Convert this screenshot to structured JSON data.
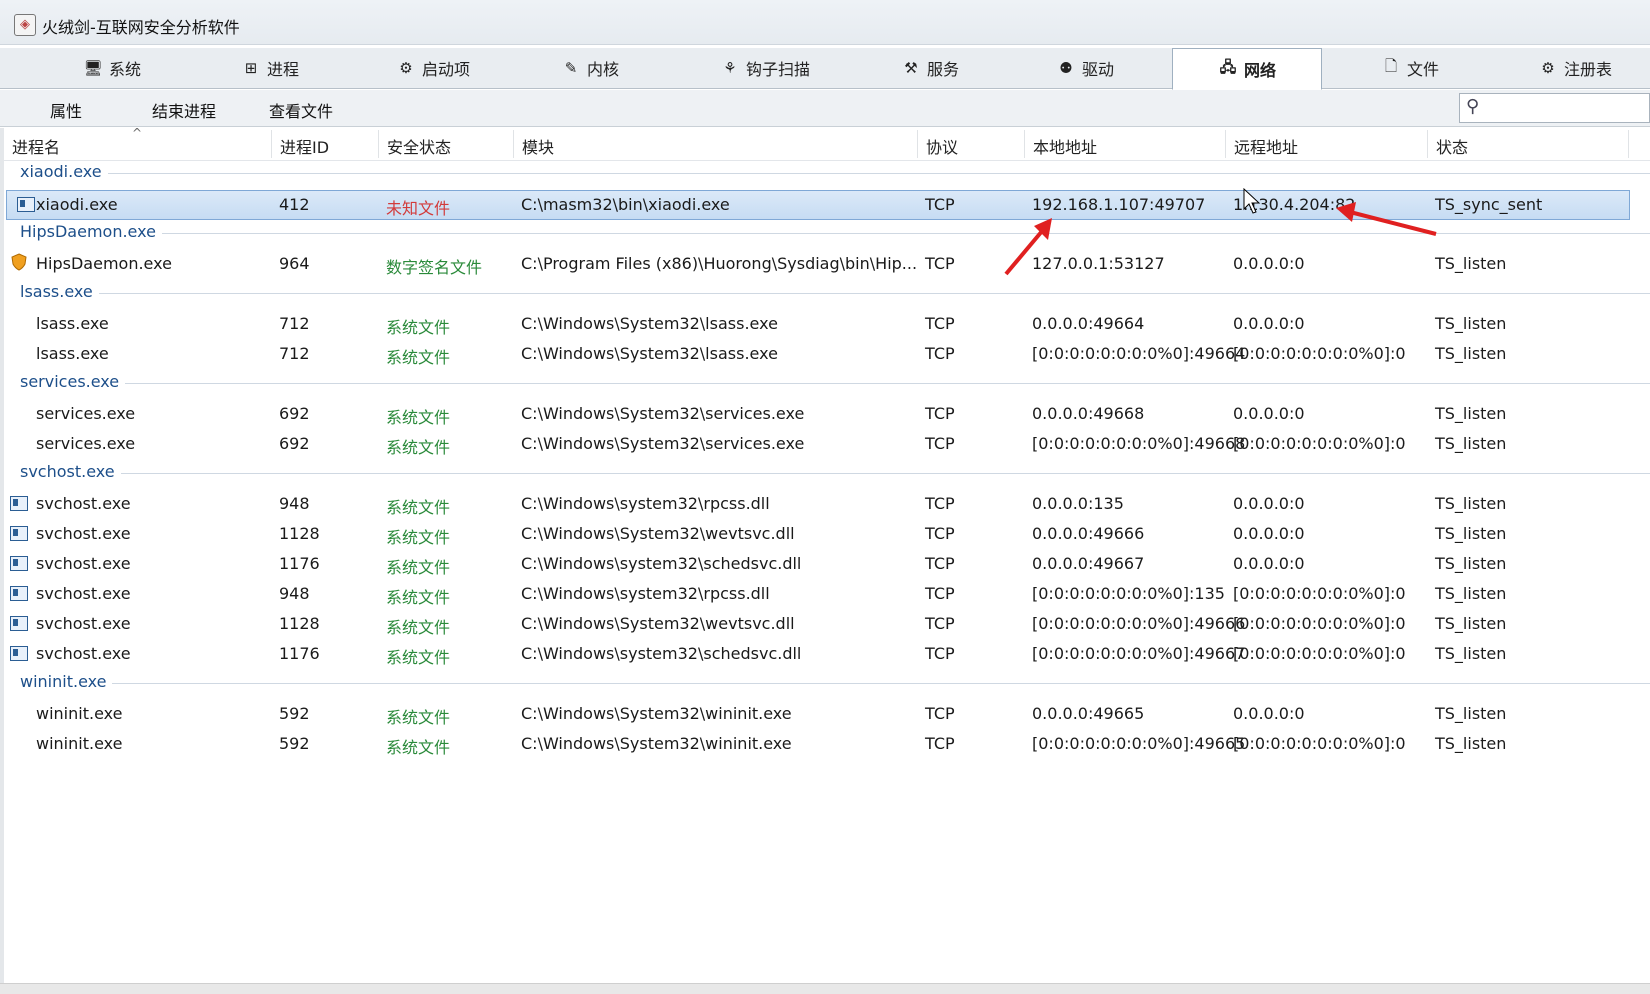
{
  "window": {
    "title": "火绒剑-互联网安全分析软件"
  },
  "tabs": [
    {
      "label": "系统",
      "icon": "monitor-icon"
    },
    {
      "label": "进程",
      "icon": "windows-logo-icon"
    },
    {
      "label": "启动项",
      "icon": "gear-icon"
    },
    {
      "label": "内核",
      "icon": "wrench-icon"
    },
    {
      "label": "钩子扫描",
      "icon": "bug-icon"
    },
    {
      "label": "服务",
      "icon": "services-icon"
    },
    {
      "label": "驱动",
      "icon": "driver-icon"
    },
    {
      "label": "网络",
      "icon": "network-icon",
      "active": true
    },
    {
      "label": "文件",
      "icon": "file-icon"
    },
    {
      "label": "注册表",
      "icon": "registry-icon"
    }
  ],
  "toolbar": {
    "properties": "属性",
    "end_process": "结束进程",
    "view_file": "查看文件"
  },
  "columns": [
    "进程名",
    "进程ID",
    "安全状态",
    "模块",
    "协议",
    "本地地址",
    "远程地址",
    "状态"
  ],
  "groups": [
    {
      "name": "xiaodi.exe",
      "rows": [
        {
          "name": "xiaodi.exe",
          "pid": "412",
          "security": "未知文件",
          "security_type": "unknown",
          "module": "C:\\masm32\\bin\\xiaodi.exe",
          "proto": "TCP",
          "local": "192.168.1.107:49707",
          "remote": "1.130.4.204:82",
          "state": "TS_sync_sent",
          "icon": "window",
          "selected": true
        }
      ]
    },
    {
      "name": "HipsDaemon.exe",
      "rows": [
        {
          "name": "HipsDaemon.exe",
          "pid": "964",
          "security": "数字签名文件",
          "security_type": "signed",
          "module": "C:\\Program Files (x86)\\Huorong\\Sysdiag\\bin\\Hip...",
          "proto": "TCP",
          "local": "127.0.0.1:53127",
          "remote": "0.0.0.0:0",
          "state": "TS_listen",
          "icon": "shield"
        }
      ]
    },
    {
      "name": "lsass.exe",
      "rows": [
        {
          "name": "lsass.exe",
          "pid": "712",
          "security": "系统文件",
          "security_type": "system",
          "module": "C:\\Windows\\System32\\lsass.exe",
          "proto": "TCP",
          "local": "0.0.0.0:49664",
          "remote": "0.0.0.0:0",
          "state": "TS_listen",
          "icon": ""
        },
        {
          "name": "lsass.exe",
          "pid": "712",
          "security": "系统文件",
          "security_type": "system",
          "module": "C:\\Windows\\System32\\lsass.exe",
          "proto": "TCP",
          "local": "[0:0:0:0:0:0:0:0%0]:49664",
          "remote": "[0:0:0:0:0:0:0:0%0]:0",
          "state": "TS_listen",
          "icon": ""
        }
      ]
    },
    {
      "name": "services.exe",
      "rows": [
        {
          "name": "services.exe",
          "pid": "692",
          "security": "系统文件",
          "security_type": "system",
          "module": "C:\\Windows\\System32\\services.exe",
          "proto": "TCP",
          "local": "0.0.0.0:49668",
          "remote": "0.0.0.0:0",
          "state": "TS_listen",
          "icon": ""
        },
        {
          "name": "services.exe",
          "pid": "692",
          "security": "系统文件",
          "security_type": "system",
          "module": "C:\\Windows\\System32\\services.exe",
          "proto": "TCP",
          "local": "[0:0:0:0:0:0:0:0%0]:49668",
          "remote": "[0:0:0:0:0:0:0:0%0]:0",
          "state": "TS_listen",
          "icon": ""
        }
      ]
    },
    {
      "name": "svchost.exe",
      "rows": [
        {
          "name": "svchost.exe",
          "pid": "948",
          "security": "系统文件",
          "security_type": "system",
          "module": "C:\\Windows\\system32\\rpcss.dll",
          "proto": "TCP",
          "local": "0.0.0.0:135",
          "remote": "0.0.0.0:0",
          "state": "TS_listen",
          "icon": "window"
        },
        {
          "name": "svchost.exe",
          "pid": "1128",
          "security": "系统文件",
          "security_type": "system",
          "module": "C:\\Windows\\System32\\wevtsvc.dll",
          "proto": "TCP",
          "local": "0.0.0.0:49666",
          "remote": "0.0.0.0:0",
          "state": "TS_listen",
          "icon": "window"
        },
        {
          "name": "svchost.exe",
          "pid": "1176",
          "security": "系统文件",
          "security_type": "system",
          "module": "C:\\Windows\\system32\\schedsvc.dll",
          "proto": "TCP",
          "local": "0.0.0.0:49667",
          "remote": "0.0.0.0:0",
          "state": "TS_listen",
          "icon": "window"
        },
        {
          "name": "svchost.exe",
          "pid": "948",
          "security": "系统文件",
          "security_type": "system",
          "module": "C:\\Windows\\system32\\rpcss.dll",
          "proto": "TCP",
          "local": "[0:0:0:0:0:0:0:0%0]:135",
          "remote": "[0:0:0:0:0:0:0:0%0]:0",
          "state": "TS_listen",
          "icon": "window"
        },
        {
          "name": "svchost.exe",
          "pid": "1128",
          "security": "系统文件",
          "security_type": "system",
          "module": "C:\\Windows\\System32\\wevtsvc.dll",
          "proto": "TCP",
          "local": "[0:0:0:0:0:0:0:0%0]:49666",
          "remote": "[0:0:0:0:0:0:0:0%0]:0",
          "state": "TS_listen",
          "icon": "window"
        },
        {
          "name": "svchost.exe",
          "pid": "1176",
          "security": "系统文件",
          "security_type": "system",
          "module": "C:\\Windows\\system32\\schedsvc.dll",
          "proto": "TCP",
          "local": "[0:0:0:0:0:0:0:0%0]:49667",
          "remote": "[0:0:0:0:0:0:0:0%0]:0",
          "state": "TS_listen",
          "icon": "window"
        }
      ]
    },
    {
      "name": "wininit.exe",
      "rows": [
        {
          "name": "wininit.exe",
          "pid": "592",
          "security": "系统文件",
          "security_type": "system",
          "module": "C:\\Windows\\System32\\wininit.exe",
          "proto": "TCP",
          "local": "0.0.0.0:49665",
          "remote": "0.0.0.0:0",
          "state": "TS_listen",
          "icon": ""
        },
        {
          "name": "wininit.exe",
          "pid": "592",
          "security": "系统文件",
          "security_type": "system",
          "module": "C:\\Windows\\System32\\wininit.exe",
          "proto": "TCP",
          "local": "[0:0:0:0:0:0:0:0%0]:49665",
          "remote": "[0:0:0:0:0:0:0:0%0]:0",
          "state": "TS_listen",
          "icon": ""
        }
      ]
    }
  ],
  "colors": {
    "unknown": "#d23a3a",
    "system": "#2a8a3a",
    "annotation_arrow": "#e02020",
    "selection": "#c6dcf3"
  }
}
